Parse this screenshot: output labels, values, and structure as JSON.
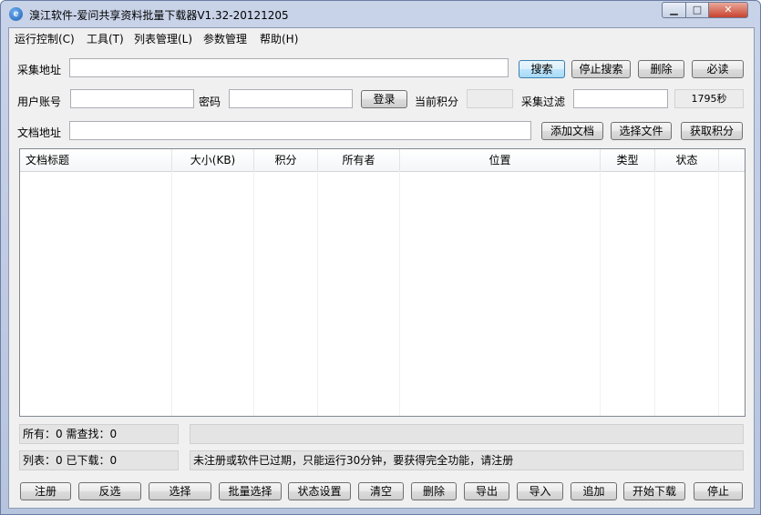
{
  "window": {
    "title": "溴江软件-爱问共享资料批量下载器V1.32-20121205",
    "controls": {
      "minimize": "▁",
      "maximize": "□",
      "close": "✕"
    }
  },
  "menu": [
    "运行控制(C)",
    "工具(T)",
    "列表管理(L)",
    "参数管理",
    "帮助(H)"
  ],
  "collect": {
    "label": "采集地址",
    "value": "",
    "buttons": [
      "搜索",
      "停止搜索",
      "删除",
      "必读"
    ]
  },
  "account": {
    "user_label": "用户账号",
    "user_value": "",
    "password_label": "密码",
    "password_value": "",
    "login_button": "登录",
    "points_label": "当前积分",
    "points_value": "",
    "filter_label": "采集过滤",
    "filter_value": "",
    "timer": "1795秒"
  },
  "document": {
    "label": "文档地址",
    "value": "",
    "buttons": [
      "添加文档",
      "选择文件",
      "获取积分"
    ]
  },
  "table": {
    "columns": [
      "文档标题",
      "大小(KB)",
      "积分",
      "所有者",
      "位置",
      "类型",
      "状态"
    ],
    "rows": []
  },
  "status": {
    "all": "所有：0 需查找：0",
    "list": "列表：0 已下载：0",
    "progress": "",
    "message": "未注册或软件已过期，只能运行30分钟，要获得完全功能，请注册"
  },
  "bottom_buttons": [
    "注册",
    "反选",
    "选择",
    "批量选择",
    "状态设置",
    "清空",
    "删除",
    "导出",
    "导入",
    "追加",
    "开始下载",
    "停止"
  ],
  "colors": {
    "title_bar": "#c3cee5",
    "panel": "#f0f0f0",
    "focus_button": "#bee6fd"
  }
}
